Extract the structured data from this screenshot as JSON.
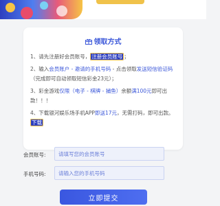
{
  "colors": {
    "accent": "#3b57d9",
    "button": "#3a57e0",
    "tag_bg": "#2d3fbf",
    "page_bg": "#f3f4f6"
  },
  "card": {
    "title": "领取方式",
    "title_icon": "gift-icon",
    "steps": [
      {
        "prefix": "1、请先注册好会员账号，",
        "tag": "注册会员账号",
        "suffix": "；"
      },
      {
        "prefix": "2、输入",
        "hl1": "会员账户 - 邀请的手机号码",
        "mid": " - 点击领取",
        "hl2": "发送短信验证码",
        "suffix": "（完成即可自动领取短信彩金23元）；"
      },
      {
        "prefix": "3、彩金游戏",
        "hl1": "仅限（电子 - 棋牌 - 捕鱼）",
        "mid": "余额",
        "hl2": "满100元",
        "suffix": "即可出款！！！"
      },
      {
        "prefix": "4、下载银河娱乐场手机APP",
        "hl1": "即送17元",
        "mid": "，无需打码，即可出款。",
        "tag": "下载"
      }
    ]
  },
  "form": {
    "account_label": "会员账号:",
    "account_placeholder": "请填写您的会员账号",
    "phone_label": "手机号码:",
    "phone_placeholder": "请输入您的手机号码",
    "submit_label": "立即提交"
  }
}
